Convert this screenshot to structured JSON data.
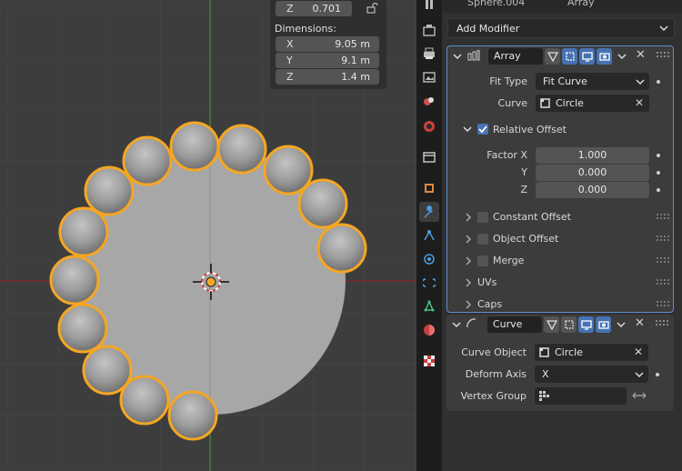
{
  "viewport": {
    "transform_panel": {
      "z_label": "Z",
      "z_value": "0.701",
      "dimensions_title": "Dimensions:",
      "dimensions": [
        {
          "axis": "X",
          "value": "9.05 m"
        },
        {
          "axis": "Y",
          "value": "9.1 m"
        },
        {
          "axis": "Z",
          "value": "1.4 m"
        }
      ]
    }
  },
  "properties": {
    "header_text": "Sphere.004",
    "header_text2": "Array",
    "add_modifier_label": "Add Modifier",
    "array_modifier": {
      "name": "Array",
      "fit_type_label": "Fit Type",
      "fit_type_value": "Fit Curve",
      "curve_label": "Curve",
      "curve_value": "Circle",
      "relative_offset_label": "Relative Offset",
      "factor_x_label": "Factor X",
      "factor_x_value": "1.000",
      "y_label": "Y",
      "y_value": "0.000",
      "z_label": "Z",
      "z_value": "0.000",
      "constant_offset_label": "Constant Offset",
      "object_offset_label": "Object Offset",
      "merge_label": "Merge",
      "uvs_label": "UVs",
      "caps_label": "Caps"
    },
    "curve_modifier": {
      "name": "Curve",
      "curve_object_label": "Curve Object",
      "curve_object_value": "Circle",
      "deform_axis_label": "Deform Axis",
      "deform_axis_value": "X",
      "vertex_group_label": "Vertex Group",
      "vertex_group_value": ""
    }
  },
  "colors": {
    "selection_outline": "#f5a623",
    "active_blue": "#4772b3",
    "x_axis": "#7d2a2a",
    "y_axis": "#4e7a2c"
  }
}
